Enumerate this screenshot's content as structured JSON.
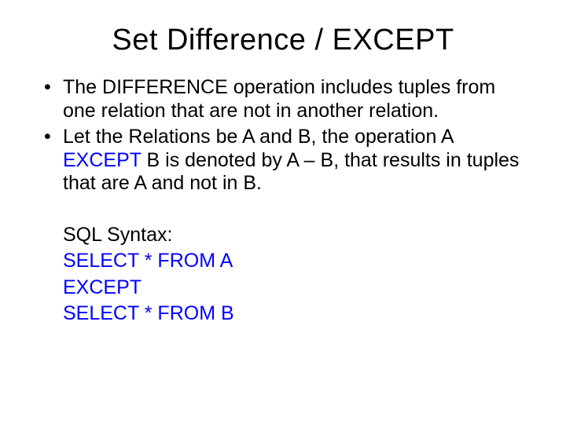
{
  "title": "Set Difference / EXCEPT",
  "bullets": {
    "b1": "The DIFFERENCE operation includes tuples from one relation that are not in another relation.",
    "b2_pre": "Let the Relations be A and B, the operation A ",
    "b2_kw": "EXCEPT",
    "b2_post": " B is denoted by A – B, that results in tuples that are A and not in B."
  },
  "sql": {
    "label": "SQL Syntax:",
    "line1": "SELECT * FROM A",
    "line2": "EXCEPT",
    "line3": "SELECT * FROM B"
  }
}
